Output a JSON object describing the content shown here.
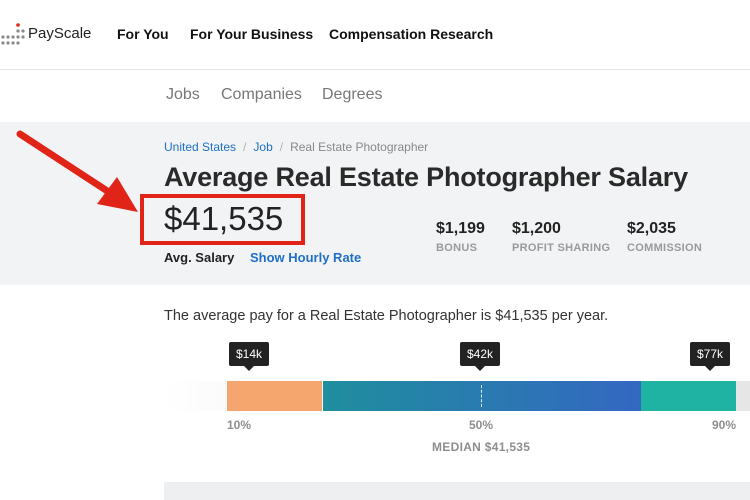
{
  "brand": {
    "name": "PayScale"
  },
  "nav": {
    "items": [
      "For You",
      "For Your Business",
      "Compensation Research"
    ]
  },
  "subnav": {
    "items": [
      "Jobs",
      "Companies",
      "Degrees"
    ]
  },
  "breadcrumb": {
    "items": [
      "United States",
      "Job",
      "Real Estate Photographer"
    ]
  },
  "header": {
    "title": "Average Real Estate Photographer Salary",
    "salary": "$41,535",
    "avg_label": "Avg. Salary",
    "hourly_link": "Show Hourly Rate"
  },
  "stats": [
    {
      "value": "$1,199",
      "label": "BONUS"
    },
    {
      "value": "$1,200",
      "label": "PROFIT SHARING"
    },
    {
      "value": "$2,035",
      "label": "COMMISSION"
    }
  ],
  "description": "The average pay for a Real Estate Photographer is $41,535 per year.",
  "range": {
    "tooltips": [
      "$14k",
      "$42k",
      "$77k"
    ],
    "percentiles": [
      "10%",
      "50%",
      "90%"
    ],
    "median_label": "MEDIAN $41,535"
  },
  "colors": {
    "accent": "#1f6fc5",
    "highlight": "#e02417",
    "low_segment": "#f5a66f",
    "mid_segment_start": "#1f8e9e",
    "mid_segment_end": "#3467c2",
    "high_segment": "#1fb3a3"
  }
}
